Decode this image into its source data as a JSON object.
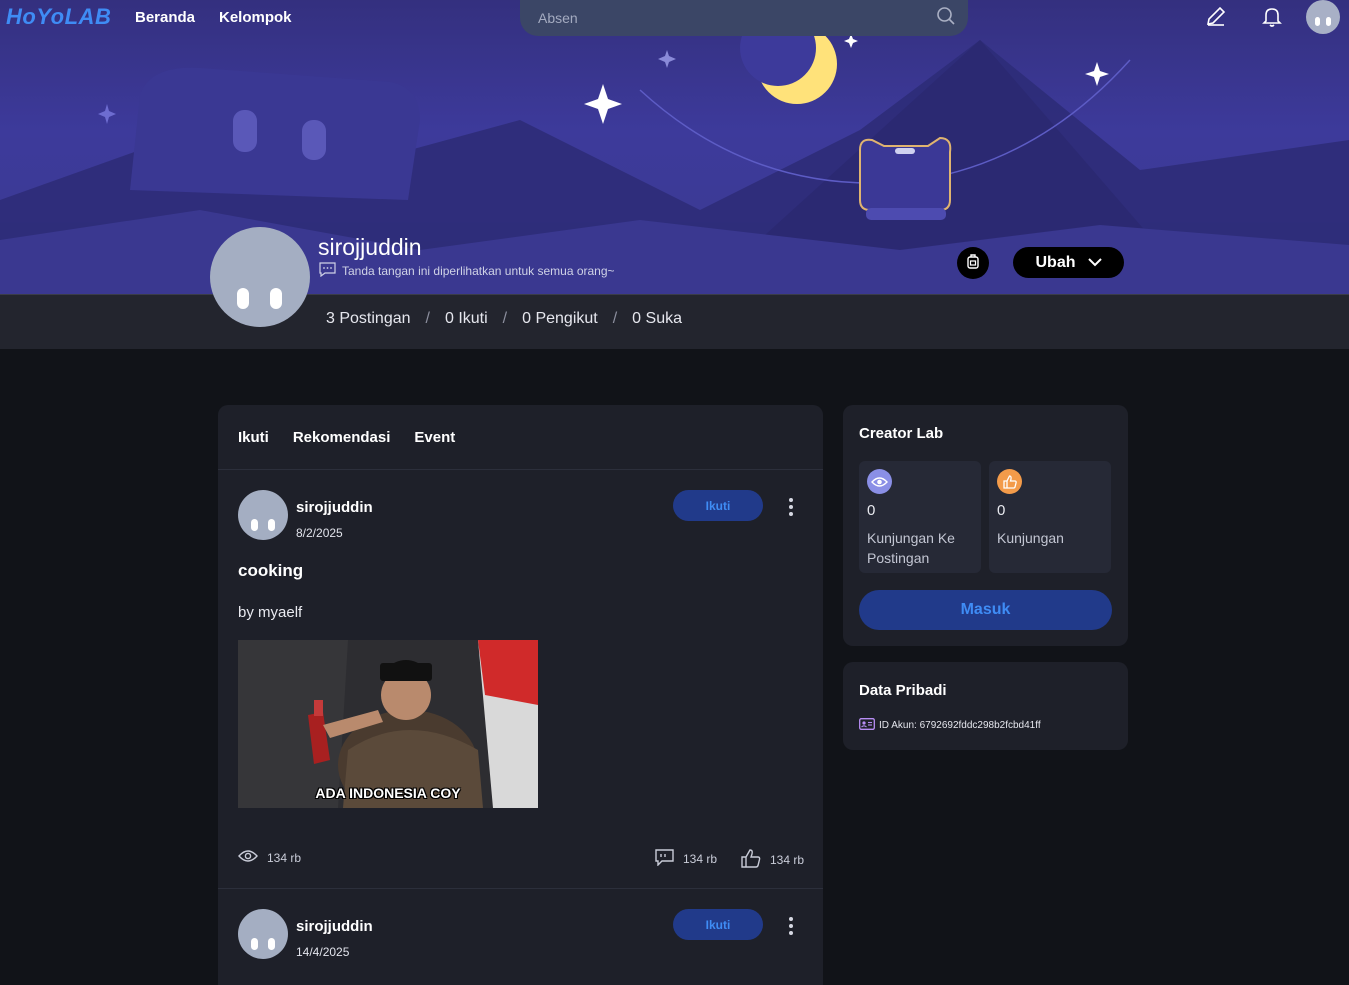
{
  "nav": {
    "logo": "HoYoLAB",
    "links": [
      "Beranda",
      "Kelompok"
    ],
    "search_placeholder": "Absen",
    "icons": [
      "search-icon",
      "pencil-icon",
      "bell-icon"
    ]
  },
  "profile": {
    "username": "sirojjuddin",
    "signature": "Tanda tangan ini diperlihatkan untuk semua orang~",
    "edit_label": "Ubah",
    "stats": [
      "3 Postingan",
      "0 Ikuti",
      "0 Pengikut",
      "0 Suka"
    ],
    "separator": "/"
  },
  "feed": {
    "tabs": [
      "Ikuti",
      "Rekomendasi",
      "Event"
    ],
    "posts": [
      {
        "user": "sirojjuddin",
        "date": "8/2/2025",
        "follow_label": "Ikuti",
        "title": "cooking",
        "body": "by myaelf",
        "image_caption": "ADA INDONESIA COY",
        "views": "134 rb",
        "comments": "134 rb",
        "likes": "134 rb"
      },
      {
        "user": "sirojjuddin",
        "date": "14/4/2025",
        "follow_label": "Ikuti"
      }
    ]
  },
  "creator_lab": {
    "title": "Creator Lab",
    "stats": [
      {
        "value": "0",
        "label": "Kunjungan Ke Postingan",
        "icon": "eye-icon",
        "color": "#8a8fe6"
      },
      {
        "value": "0",
        "label": "Kunjungan",
        "icon": "thumb-icon",
        "color": "#f39b4a"
      }
    ],
    "login_label": "Masuk"
  },
  "personal": {
    "title": "Data Pribadi",
    "account_id": "ID Akun: 6792692fddc298b2fcbd41ff"
  },
  "colors": {
    "accent": "#3f8cf5",
    "button_bg": "#213a8a",
    "card_bg": "#1e2029",
    "page_bg": "#111318"
  }
}
